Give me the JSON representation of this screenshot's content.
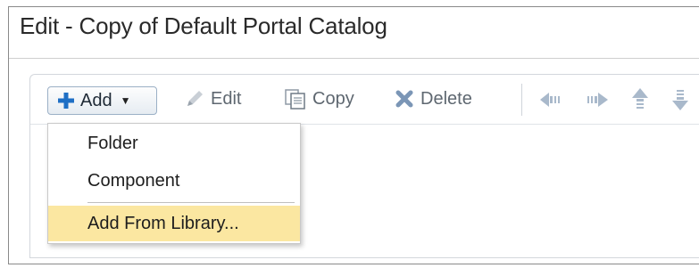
{
  "dialog": {
    "title": "Edit - Copy of Default Portal Catalog"
  },
  "toolbar": {
    "add_label": "Add",
    "edit_label": "Edit",
    "copy_label": "Copy",
    "delete_label": "Delete",
    "icons": [
      "plus-icon",
      "chevron-down-icon",
      "pencil-icon",
      "copy-icon",
      "delete-x-icon",
      "move-left-icon",
      "move-right-icon",
      "move-up-icon",
      "move-down-icon"
    ]
  },
  "add_menu": {
    "items": [
      {
        "label": "Folder"
      },
      {
        "label": "Component"
      },
      {
        "label": "Add From Library...",
        "highlighted": true
      }
    ]
  },
  "colors": {
    "accent_blue": "#1f6fc5",
    "highlight": "#fbe7a1",
    "delete_icon": "#7b96b6",
    "arrow_icon": "#a9b9cb"
  }
}
